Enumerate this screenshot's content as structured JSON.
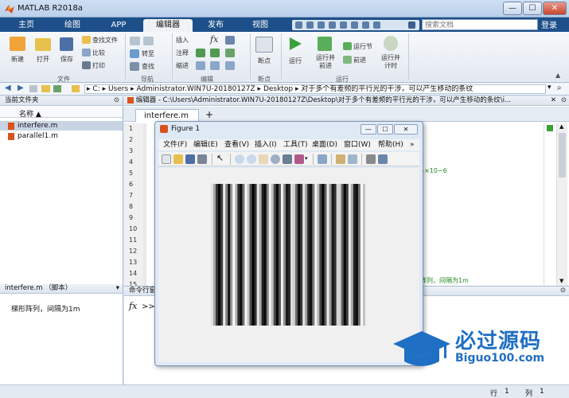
{
  "window": {
    "title": "MATLAB R2018a",
    "min": "—",
    "max": "☐",
    "close": "✕"
  },
  "tabs": [
    "主页",
    "绘图",
    "APP",
    "编辑器",
    "发布",
    "视图"
  ],
  "search": {
    "placeholder": "搜索文档",
    "login": "登录"
  },
  "ribbon": {
    "file": {
      "new": "新建",
      "open": "打开",
      "save": "保存",
      "find_files": "查找文件",
      "compare": "比较",
      "print": "打印",
      "section": "文件"
    },
    "navigate": {
      "goto": "转至",
      "find": "查找",
      "section": "导航"
    },
    "edit": {
      "insert": "插入",
      "fx": "fx",
      "comment": "注释",
      "indent": "缩进",
      "section": "编辑"
    },
    "breakpoint": {
      "label": "断点",
      "section": "断点"
    },
    "run": {
      "run": "运行",
      "run_advance": "运行并\n前进",
      "run_section": "运行节",
      "advance": "前进",
      "run_time": "运行并\n计时",
      "section": "运行"
    }
  },
  "address": {
    "segments": [
      "C:",
      "Users",
      "Administrator.WIN7U-20180127Z",
      "Desktop",
      "对于多个有差频的平行光的干涉，可以产生移动的条纹"
    ]
  },
  "current_folder": {
    "title": "当前文件夹",
    "column": "名称 ▲",
    "files": [
      "interfere.m",
      "parallel1.m"
    ]
  },
  "details": {
    "title": "interfere.m （脚本）",
    "text": "梯形阵列，间隔为1m"
  },
  "editor": {
    "title": "编辑器 - C:\\Users\\Administrator.WIN7U-20180127Z\\Desktop\\对于多个有差频的平行光的干涉，可以产生移动的条纹\\i...",
    "tab": "interfere.m",
    "add": "+",
    "lines": [
      "1",
      "2",
      "3",
      "4",
      "5",
      "6",
      "7",
      "8",
      "9",
      "10",
      "11",
      "12",
      "13",
      "14",
      "15"
    ],
    "snippet1": "5×10−6",
    "snippet2": "阵列，间隔为1m"
  },
  "command": {
    "title": "命令行窗",
    "prompt": ">>",
    "fx": "fx"
  },
  "status": {
    "row_label": "行",
    "row": "1",
    "col_label": "列",
    "col": "1"
  },
  "figure": {
    "title": "Figure 1",
    "menu": [
      "文件(F)",
      "编辑(E)",
      "查看(V)",
      "插入(I)",
      "工具(T)",
      "桌面(D)",
      "窗口(W)",
      "帮助(H)"
    ],
    "stripes": [
      0.88,
      0.64,
      0.21,
      0.02,
      0.25,
      0.92,
      0.52,
      0.07,
      0.6,
      0.99,
      0.7,
      0.18,
      0.05,
      0.45,
      0.97,
      0.78,
      0.31,
      0.01,
      0.2,
      0.9,
      0.66,
      0.12,
      0.04,
      0.5,
      0.95,
      0.74,
      0.28,
      0.02,
      0.33,
      0.94,
      0.55,
      0.09,
      0.16,
      0.86,
      0.8,
      0.4,
      0.03,
      0.22,
      0.89,
      0.61,
      0.14,
      0.06,
      0.48,
      0.96,
      0.72,
      0.26,
      0.01,
      0.37,
      0.93,
      0.58,
      0.1,
      0.19,
      0.84,
      0.82,
      0.36,
      0.03,
      0.24,
      0.91,
      0.67,
      0.13,
      0.05,
      0.44,
      0.98,
      0.76
    ]
  },
  "watermark": {
    "brand": "必过源码",
    "site": "Biguo100.com"
  }
}
